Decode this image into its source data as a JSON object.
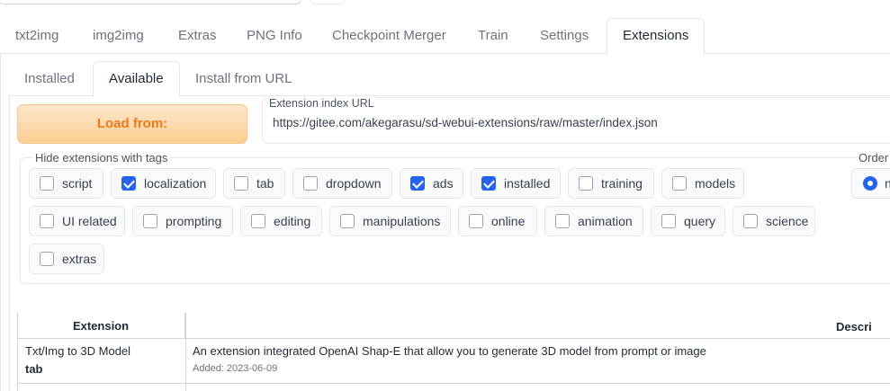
{
  "main_tabs": [
    "txt2img",
    "img2img",
    "Extras",
    "PNG Info",
    "Checkpoint Merger",
    "Train",
    "Settings",
    "Extensions"
  ],
  "active_main_tab": "Extensions",
  "sub_tabs": [
    "Installed",
    "Available",
    "Install from URL"
  ],
  "active_sub_tab": "Available",
  "load_button": "Load from:",
  "extension_index": {
    "label": "Extension index URL",
    "value": "https://gitee.com/akegarasu/sd-webui-extensions/raw/master/index.json"
  },
  "hide_tags": {
    "label": "Hide extensions with tags",
    "tags": [
      {
        "label": "script",
        "checked": false
      },
      {
        "label": "localization",
        "checked": true
      },
      {
        "label": "tab",
        "checked": false
      },
      {
        "label": "dropdown",
        "checked": false
      },
      {
        "label": "ads",
        "checked": true
      },
      {
        "label": "installed",
        "checked": true
      },
      {
        "label": "training",
        "checked": false
      },
      {
        "label": "models",
        "checked": false
      },
      {
        "label": "UI related",
        "checked": false
      },
      {
        "label": "prompting",
        "checked": false
      },
      {
        "label": "editing",
        "checked": false
      },
      {
        "label": "manipulations",
        "checked": false
      },
      {
        "label": "online",
        "checked": false
      },
      {
        "label": "animation",
        "checked": false
      },
      {
        "label": "query",
        "checked": false
      },
      {
        "label": "science",
        "checked": false
      },
      {
        "label": "extras",
        "checked": false
      }
    ]
  },
  "order": {
    "label": "Order",
    "selected_option_partial": "n"
  },
  "table": {
    "headers": [
      "Extension",
      "Descri"
    ],
    "rows": [
      {
        "name": "Txt/Img to 3D Model",
        "tag": "tab",
        "description": "An extension integrated OpenAI Shap-E that allow you to generate 3D model from prompt or image",
        "added": "Added: 2023-06-09"
      }
    ]
  }
}
